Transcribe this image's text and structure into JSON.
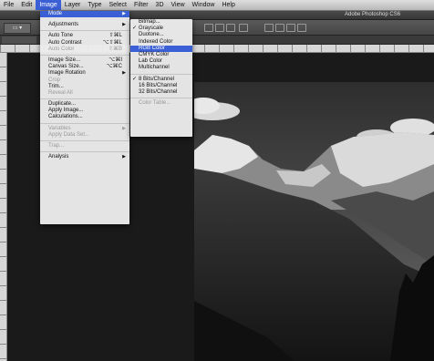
{
  "menubar": {
    "items": [
      "File",
      "Edit",
      "Image",
      "Layer",
      "Type",
      "Select",
      "Filter",
      "3D",
      "View",
      "Window",
      "Help"
    ],
    "active_index": 2
  },
  "app": {
    "title": "Adobe Photoshop CS6"
  },
  "image_menu": {
    "mode": "Mode",
    "adjustments": "Adjustments",
    "auto_tone": "Auto Tone",
    "auto_tone_sc": "⇧⌘L",
    "auto_contrast": "Auto Contrast",
    "auto_contrast_sc": "⌥⇧⌘L",
    "auto_color": "Auto Color",
    "auto_color_sc": "⇧⌘B",
    "image_size": "Image Size...",
    "image_size_sc": "⌥⌘I",
    "canvas_size": "Canvas Size...",
    "canvas_size_sc": "⌥⌘C",
    "image_rotation": "Image Rotation",
    "crop": "Crop",
    "trim": "Trim...",
    "reveal_all": "Reveal All",
    "duplicate": "Duplicate...",
    "apply_image": "Apply Image...",
    "calculations": "Calculations...",
    "variables": "Variables",
    "apply_data_set": "Apply Data Set...",
    "trap": "Trap...",
    "analysis": "Analysis"
  },
  "mode_menu": {
    "bitmap": "Bitmap...",
    "grayscale": "Grayscale",
    "duotone": "Duotone...",
    "indexed_color": "Indexed Color",
    "rgb_color": "RGB Color",
    "cmyk_color": "CMYK Color",
    "lab_color": "Lab Color",
    "multichannel": "Multichannel",
    "bits8": "8 Bits/Channel",
    "bits16": "16 Bits/Channel",
    "bits32": "32 Bits/Channel",
    "color_table": "Color Table...",
    "checked_mode": "Grayscale",
    "checked_depth": "8 Bits/Channel",
    "highlighted": "RGB Color"
  },
  "colors": {
    "highlight": "#3b5fd4",
    "menu_bg": "#ebebeb"
  }
}
